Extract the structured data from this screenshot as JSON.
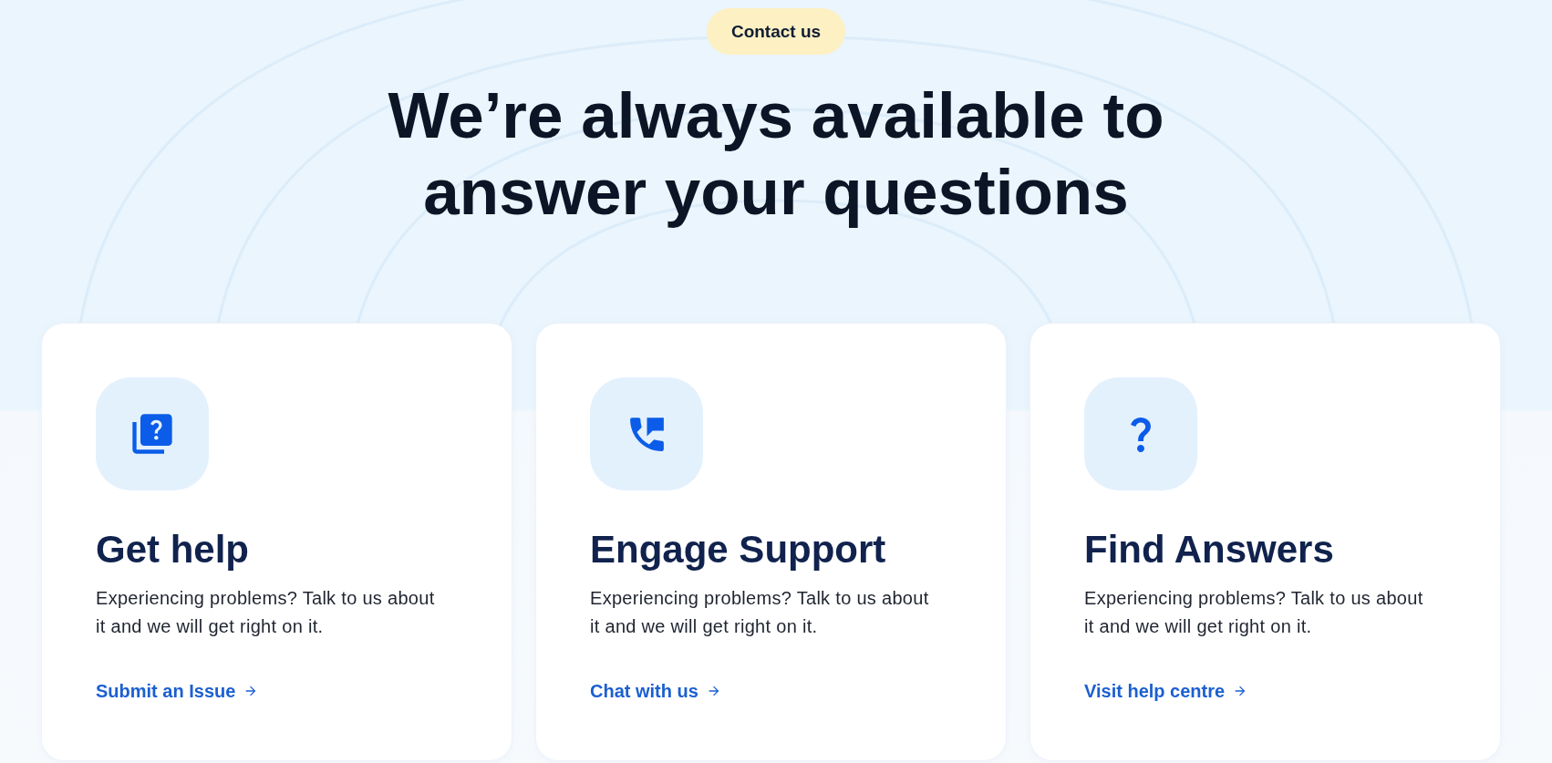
{
  "badge": {
    "label": "Contact us"
  },
  "heading": "We’re always available to answer your questions",
  "cards": [
    {
      "kind": "help-book",
      "title": "Get help",
      "description": "Experiencing problems? Talk to us about it and we will get right on it.",
      "link": "Submit an Issue"
    },
    {
      "kind": "phone-message",
      "title": "Engage Support",
      "description": "Experiencing problems? Talk to us about it and we will get right on it.",
      "link": "Chat with us"
    },
    {
      "kind": "question",
      "title": "Find Answers",
      "description": "Experiencing problems? Talk to us about it and we will get right on it.",
      "link": "Visit help centre"
    }
  ]
}
